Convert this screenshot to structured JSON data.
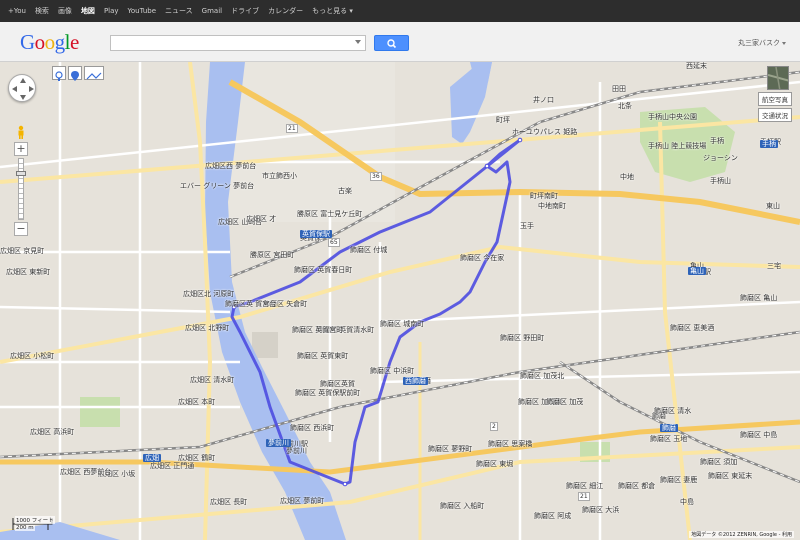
{
  "topbar": {
    "items": [
      "+You",
      "検索",
      "画像",
      "地図",
      "Play",
      "YouTube",
      "ニュース",
      "Gmail",
      "ドライブ",
      "カレンダー",
      "もっと見る ▾"
    ],
    "active_index": 3
  },
  "header": {
    "logo_letters": [
      {
        "ch": "G",
        "color": "#3369e8"
      },
      {
        "ch": "o",
        "color": "#d50f25"
      },
      {
        "ch": "o",
        "color": "#eeb211"
      },
      {
        "ch": "g",
        "color": "#3369e8"
      },
      {
        "ch": "l",
        "color": "#009925"
      },
      {
        "ch": "e",
        "color": "#d50f25"
      }
    ],
    "search_value": "",
    "search_icon": "magnifier-icon",
    "user_label": "丸三家バスク"
  },
  "map_controls": {
    "zoom_in": "+",
    "zoom_out": "−",
    "zoom_level_fraction": 0.78,
    "satellite_label": "航空写真",
    "traffic_label": "交通状況",
    "tool_icons": [
      "my-places-icon",
      "placemark-icon",
      "line-icon"
    ]
  },
  "scale": {
    "feet": "1000 フィート",
    "meters": "200 m"
  },
  "copyright": "地図データ ©2012 ZENRIN, Google - 利用",
  "colors": {
    "route": "#4c4ce0",
    "expressway": "#f6c85f",
    "highway": "#fbe6a3",
    "river": "#a9bff0",
    "park": "#c8dfae",
    "railway": "#888888"
  },
  "labels": {
    "north": [
      "西延末",
      "田田",
      "井ノ口",
      "町坪",
      "ホーユウパレス 姫路",
      "北条",
      "手柄山中央公園",
      "手柄山 陸上競技場",
      "ジョーシン",
      "中地",
      "手柄",
      "手柄山",
      "手柄駅"
    ],
    "west": [
      "広畑区西 夢前台",
      "エバー グリーン 夢前台",
      "広畑区 山崎台",
      "広畑区 才",
      "広畑区 京見町",
      "広畑区 東新町",
      "広畑区北 河原町",
      "広畑区 北野町",
      "広畑区 清水町",
      "広畑区 正門通",
      "広畑区 小松町",
      "広畑区 本町"
    ],
    "center": [
      "古楽",
      "市立飾西小",
      "勝原区 富士見ケ丘町",
      "英賀保",
      "勝原区 宮田町",
      "飾磨区 英賀春日町",
      "飾磨区 矢倉町",
      "飾磨区英 賀宮台",
      "飾磨区 付城",
      "飾磨区 英賀東町",
      "飾磨区英賀",
      "飾磨区 英賀清水町",
      "飾磨区 英賀宮町",
      "飾磨区 英賀保駅前町",
      "夢前川",
      "夢前川駅",
      "飾磨区 西浜町",
      "西飾磨",
      "飾磨区 中浜町"
    ],
    "east": [
      "町坪南町",
      "中地南町",
      "飾磨区 今在家",
      "玉手",
      "飾磨区 城南町",
      "飾磨区 野田町",
      "飾磨区 加茂北",
      "飾磨区 加茂東",
      "飾磨区 加茂",
      "飾磨区 思案橋",
      "飾磨区 蓼野町",
      "飾磨区 東堀",
      "飾磨",
      "飾磨区 清水",
      "飾磨区 玉地",
      "飾磨区 須加",
      "飾磨区 中島",
      "亀山",
      "飾磨区 亀山",
      "亀山駅",
      "飾磨区 恵美酒",
      "飾磨区 細江",
      "飾磨区 都倉",
      "飾磨区 大浜",
      "飾磨区 妻鹿",
      "飾磨区 東延末",
      "東山",
      "三宅",
      "中島"
    ],
    "south": [
      "広畑区 夢前町",
      "広畑区 鶴町",
      "広畑区 小坂",
      "広畑区 高浜町",
      "広畑区 西夢前台",
      "広畑区 長町",
      "飾磨区 入船町",
      "飾磨区 阿成"
    ],
    "stations": [
      "英賀保駅",
      "西飾磨",
      "夢前川",
      "手柄",
      "亀山",
      "飾磨",
      "広畑"
    ],
    "roads": [
      "21",
      "65",
      "36",
      "2",
      "21"
    ]
  }
}
